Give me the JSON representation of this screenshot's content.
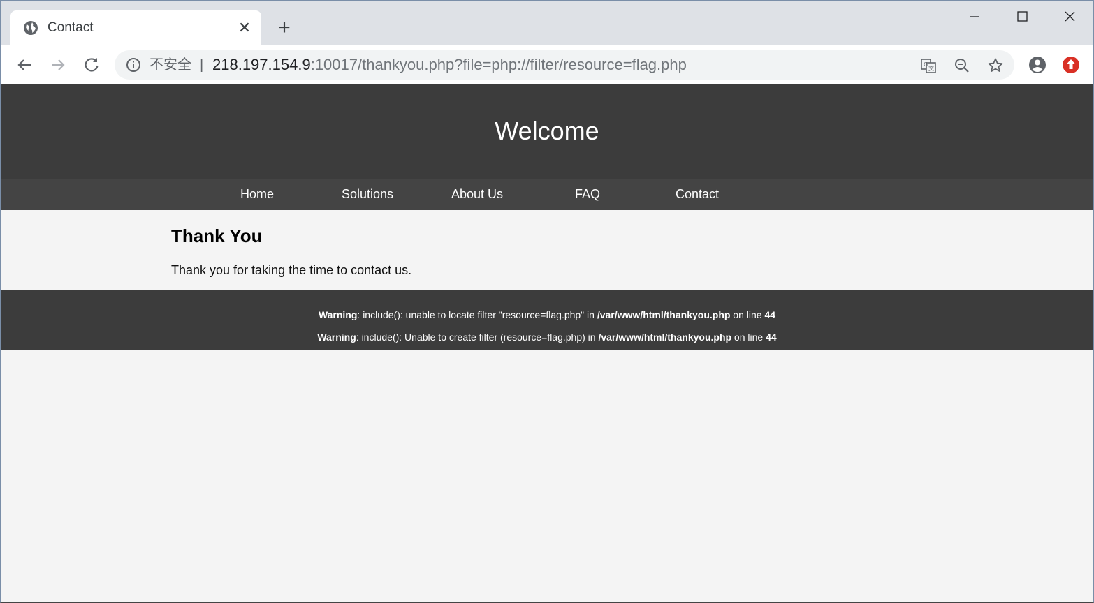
{
  "browser": {
    "tab_title": "Contact",
    "security_label": "不安全",
    "separator": "|",
    "url_host": "218.197.154.9",
    "url_rest": ":10017/thankyou.php?file=php://filter/resource=flag.php",
    "icons": {
      "tab": "globe-icon",
      "close": "close-icon",
      "new_tab": "plus-icon",
      "back": "back-arrow-icon",
      "forward": "forward-arrow-icon",
      "reload": "reload-icon",
      "info": "info-icon",
      "translate": "translate-icon",
      "zoom": "zoom-out-icon",
      "bookmark": "star-icon",
      "profile": "account-icon",
      "update": "update-icon"
    },
    "colors": {
      "tabstrip": "#dee1e6",
      "update_badge": "#d93025"
    }
  },
  "site": {
    "banner_title": "Welcome",
    "nav": [
      "Home",
      "Solutions",
      "About Us",
      "FAQ",
      "Contact"
    ],
    "heading": "Thank You",
    "message": "Thank you for taking the time to contact us.",
    "warnings": [
      {
        "label": "Warning",
        "text": ": include(): unable to locate filter \"resource=flag.php\" in ",
        "file": "/var/www/html/thankyou.php",
        "on_line": " on line ",
        "line": "44"
      },
      {
        "label": "Warning",
        "text": ": include(): Unable to create filter (resource=flag.php) in ",
        "file": "/var/www/html/thankyou.php",
        "on_line": " on line ",
        "line": "44"
      }
    ],
    "colors": {
      "banner": "#3c3c3c",
      "nav": "#444444",
      "body": "#f4f4f4"
    }
  }
}
